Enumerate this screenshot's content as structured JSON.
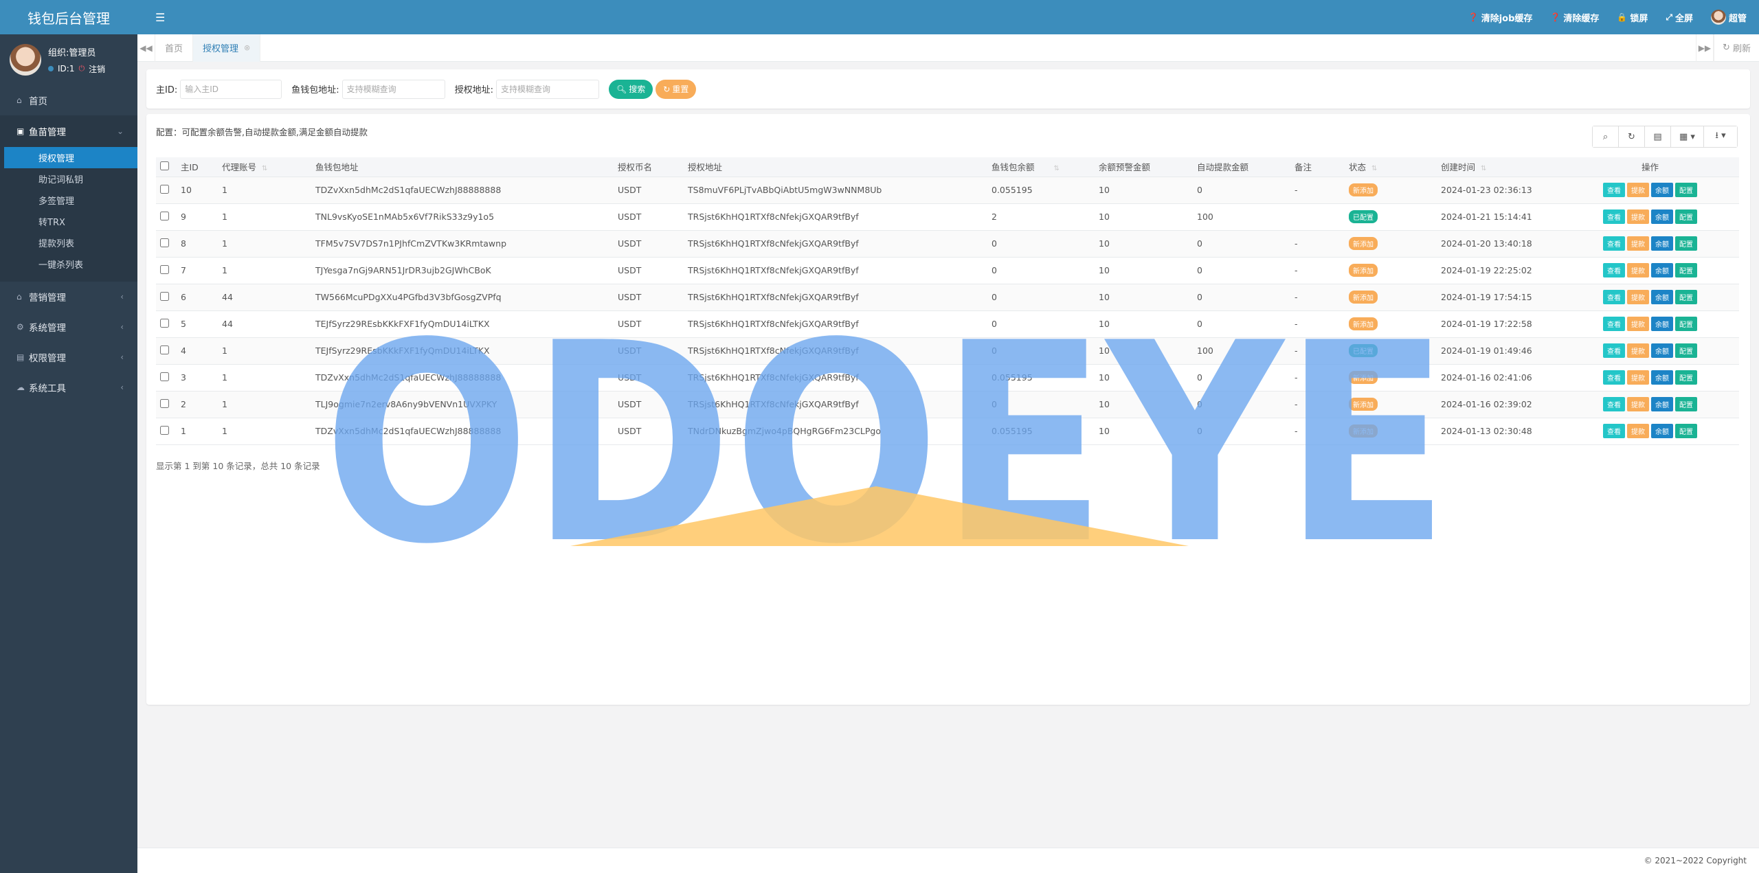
{
  "brand": {
    "title": "钱包后台管理"
  },
  "profile": {
    "name": "组织:管理员",
    "id_text": "ID:1",
    "logout": "注销"
  },
  "sidebar": {
    "items": [
      {
        "label": "首页",
        "icon": "home-icon"
      },
      {
        "label": "鱼苗管理",
        "icon": "money-icon",
        "open": true
      },
      {
        "label": "营销管理",
        "icon": "bank-icon"
      },
      {
        "label": "系统管理",
        "icon": "gear-icon"
      },
      {
        "label": "权限管理",
        "icon": "id-card-icon"
      },
      {
        "label": "系统工具",
        "icon": "cloud-icon"
      }
    ],
    "submenu": [
      "授权管理",
      "助记词私钥",
      "多签管理",
      "转TRX",
      "提款列表",
      "一键杀列表"
    ]
  },
  "topbar": {
    "actions": [
      {
        "label": "清除job缓存",
        "icon": "question-circle-icon"
      },
      {
        "label": "清除缓存",
        "icon": "question-circle-icon"
      },
      {
        "label": "锁屏",
        "icon": "lock-icon"
      },
      {
        "label": "全屏",
        "icon": "fullscreen-icon"
      }
    ],
    "user": "超管"
  },
  "tabs": {
    "items": [
      "首页",
      "授权管理"
    ],
    "refresh": "刷新"
  },
  "search": {
    "fields": [
      {
        "label": "主ID:",
        "placeholder": "输入主ID"
      },
      {
        "label": "鱼钱包地址:",
        "placeholder": "支持模糊查询"
      },
      {
        "label": "授权地址:",
        "placeholder": "支持模糊查询"
      }
    ],
    "search_btn": "搜索",
    "reset_btn": "重置"
  },
  "main": {
    "note": "配置：可配置余额告警,自动提款金额,满足金额自动提款",
    "columns": [
      "主ID",
      "代理账号",
      "鱼钱包地址",
      "授权币名",
      "授权地址",
      "鱼钱包余额",
      "余额预警金额",
      "自动提款金额",
      "备注",
      "状态",
      "创建时间",
      "操作"
    ],
    "ops": [
      "查看",
      "提款",
      "余额",
      "配置"
    ],
    "rows": [
      {
        "id": "10",
        "agent": "1",
        "wallet": "TDZvXxn5dhMc2dS1qfaUECWzhJ88888888",
        "coin": "USDT",
        "auth": "TS8muVF6PLjTvABbQiAbtU5mgW3wNNM8Ub",
        "balance": "0.055195",
        "warn": "10",
        "auto": "0",
        "remark": "-",
        "status": "新添加",
        "status_type": "new",
        "created": "2024-01-23 02:36:13"
      },
      {
        "id": "9",
        "agent": "1",
        "wallet": "TNL9vsKyoSE1nMAb5x6Vf7RikS33z9y1o5",
        "coin": "USDT",
        "auth": "TRSjst6KhHQ1RTXf8cNfekjGXQAR9tfByf",
        "balance": "2",
        "warn": "10",
        "auto": "100",
        "remark": "",
        "status": "已配置",
        "status_type": "done",
        "created": "2024-01-21 15:14:41"
      },
      {
        "id": "8",
        "agent": "1",
        "wallet": "TFM5v7SV7DS7n1PJhfCmZVTKw3KRmtawnp",
        "coin": "USDT",
        "auth": "TRSjst6KhHQ1RTXf8cNfekjGXQAR9tfByf",
        "balance": "0",
        "warn": "10",
        "auto": "0",
        "remark": "-",
        "status": "新添加",
        "status_type": "new",
        "created": "2024-01-20 13:40:18"
      },
      {
        "id": "7",
        "agent": "1",
        "wallet": "TJYesga7nGj9ARN51JrDR3ujb2GJWhCBoK",
        "coin": "USDT",
        "auth": "TRSjst6KhHQ1RTXf8cNfekjGXQAR9tfByf",
        "balance": "0",
        "warn": "10",
        "auto": "0",
        "remark": "-",
        "status": "新添加",
        "status_type": "new",
        "created": "2024-01-19 22:25:02"
      },
      {
        "id": "6",
        "agent": "44",
        "wallet": "TW566McuPDgXXu4PGfbd3V3bfGosgZVPfq",
        "coin": "USDT",
        "auth": "TRSjst6KhHQ1RTXf8cNfekjGXQAR9tfByf",
        "balance": "0",
        "warn": "10",
        "auto": "0",
        "remark": "-",
        "status": "新添加",
        "status_type": "new",
        "created": "2024-01-19 17:54:15"
      },
      {
        "id": "5",
        "agent": "44",
        "wallet": "TEJfSyrz29REsbKKkFXF1fyQmDU14iLTKX",
        "coin": "USDT",
        "auth": "TRSjst6KhHQ1RTXf8cNfekjGXQAR9tfByf",
        "balance": "0",
        "warn": "10",
        "auto": "0",
        "remark": "-",
        "status": "新添加",
        "status_type": "new",
        "created": "2024-01-19 17:22:58"
      },
      {
        "id": "4",
        "agent": "1",
        "wallet": "TEJfSyrz29REsbKKkFXF1fyQmDU14iLTKX",
        "coin": "USDT",
        "auth": "TRSjst6KhHQ1RTXf8cNfekjGXQAR9tfByf",
        "balance": "0",
        "warn": "10",
        "auto": "100",
        "remark": "-",
        "status": "已配置",
        "status_type": "done",
        "created": "2024-01-19 01:49:46"
      },
      {
        "id": "3",
        "agent": "1",
        "wallet": "TDZvXxn5dhMc2dS1qfaUECWzhJ88888888",
        "coin": "USDT",
        "auth": "TRSjst6KhHQ1RTXf8cNfekjGXQAR9tfByf",
        "balance": "0.055195",
        "warn": "10",
        "auto": "0",
        "remark": "-",
        "status": "新添加",
        "status_type": "new",
        "created": "2024-01-16 02:41:06"
      },
      {
        "id": "2",
        "agent": "1",
        "wallet": "TLJ9ogmie7n2erv8A6ny9bVENVn1UVXPKY",
        "coin": "USDT",
        "auth": "TRSjst6KhHQ1RTXf8cNfekjGXQAR9tfByf",
        "balance": "0",
        "warn": "10",
        "auto": "0",
        "remark": "-",
        "status": "新添加",
        "status_type": "new",
        "created": "2024-01-16 02:39:02"
      },
      {
        "id": "1",
        "agent": "1",
        "wallet": "TDZvXxn5dhMc2dS1qfaUECWzhJ88888888",
        "coin": "USDT",
        "auth": "TNdrDNkuzBgmZjwo4pBQHgRG6Fm23CLPgo",
        "balance": "0.055195",
        "warn": "10",
        "auto": "0",
        "remark": "-",
        "status": "新添加",
        "status_type": "new",
        "created": "2024-01-13 02:30:48"
      }
    ],
    "pager": "显示第 1 到第 10 条记录，总共 10 条记录"
  },
  "watermark": {
    "text": "ODOEYE"
  },
  "footer": {
    "copyright": "© 2021~2022 Copyright"
  },
  "colors": {
    "header": "#3c8dbc",
    "sidebar": "#2f4050",
    "primary": "#1ab394",
    "warning": "#f8ac59",
    "info": "#23c6c8"
  }
}
